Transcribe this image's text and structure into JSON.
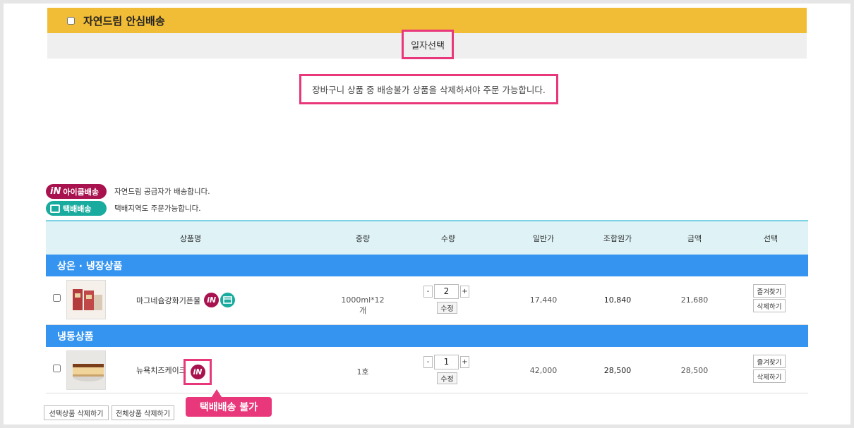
{
  "section": {
    "title": "자연드림 안심배송",
    "date_select": "일자선택"
  },
  "notice": "장바구니 상품 중 배송불가 상품을 삭제하셔야 주문 가능합니다.",
  "legend": [
    {
      "badge": "아이쿱배송",
      "text": "자연드림 공급자가 배송합니다.",
      "icon": "in-logo-icon",
      "color": "#a8124e"
    },
    {
      "badge": "택배배송",
      "text": "택배지역도 주문가능합니다.",
      "icon": "box-icon",
      "color": "#1aab9f"
    }
  ],
  "table": {
    "headers": [
      "상품명",
      "중량",
      "수량",
      "일반가",
      "조합원가",
      "금액",
      "선택"
    ],
    "categories": [
      {
        "name": "상온 · 냉장상품",
        "items": [
          {
            "name": "마그네슘강화기픈물",
            "weight": "1000ml*12개",
            "qty": "2",
            "price": "17,440",
            "member_price": "10,840",
            "amount": "21,680",
            "badges": [
              "iN",
              "box"
            ]
          }
        ]
      },
      {
        "name": "냉동상품",
        "items": [
          {
            "name": "뉴욕치즈케이크",
            "weight": "1호",
            "qty": "1",
            "price": "42,000",
            "member_price": "28,500",
            "amount": "28,500",
            "badges": [
              "iN"
            ]
          }
        ]
      }
    ],
    "qty_minus": "-",
    "qty_plus": "+",
    "qty_fix": "수정",
    "favorite": "즐겨찾기",
    "delete": "삭제하기"
  },
  "callout": "택배배송 불가",
  "bottom": {
    "delete_selected": "선택상품 삭제하기",
    "delete_all": "전체상품 삭제하기"
  },
  "colors": {
    "header_yellow": "#f2bd36",
    "category_blue": "#3494f0",
    "highlight_pink": "#e8377a",
    "table_head": "#dff3f7"
  }
}
